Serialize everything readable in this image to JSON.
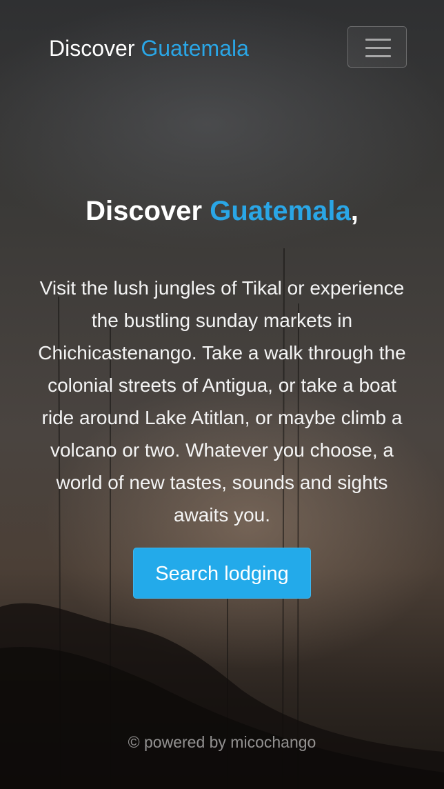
{
  "navbar": {
    "brand_prefix": "Discover",
    "brand_accent": "Guatemala",
    "menu_icon": "hamburger-menu-icon"
  },
  "hero": {
    "title_prefix": "Discover",
    "title_accent": "Guatemala",
    "title_suffix": ",",
    "body": "Visit the lush jungles of Tikal or experience the bustling sunday markets in Chichicastenango. Take a walk through the colonial streets of Antigua, or take a boat ride around Lake Atitlan, or maybe climb a volcano or two. Whatever you choose, a world of new tastes, sounds and sights awaits you.",
    "cta_label": "Search lodging"
  },
  "footer": {
    "text": "© powered by micochango"
  },
  "colors": {
    "accent": "#2aa6e6",
    "button": "#23aaea",
    "text": "#ffffff"
  }
}
